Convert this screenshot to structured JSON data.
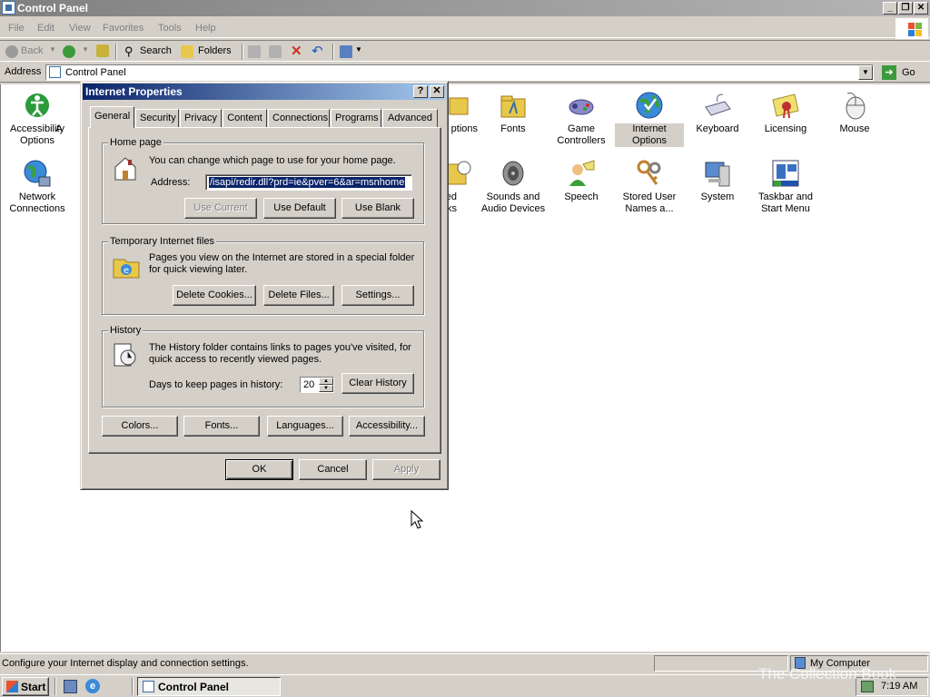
{
  "window": {
    "title": "Control Panel"
  },
  "menu": [
    "File",
    "Edit",
    "View",
    "Favorites",
    "Tools",
    "Help"
  ],
  "toolbar": {
    "back": "Back",
    "search": "Search",
    "folders": "Folders"
  },
  "address": {
    "label": "Address",
    "value": "Control Panel",
    "go": "Go"
  },
  "items": [
    {
      "label": "Accessibility Options",
      "icon": "accessibility-icon",
      "sel": false
    },
    {
      "label": "A",
      "icon": "add-hardware-icon",
      "sel": false
    },
    {
      "label": "ptions",
      "icon": "folder-options-icon",
      "sel": false
    },
    {
      "label": "Fonts",
      "icon": "fonts-folder-icon",
      "sel": false
    },
    {
      "label": "Game Controllers",
      "icon": "gamepad-icon",
      "sel": false
    },
    {
      "label": "Internet Options",
      "icon": "globe-icon",
      "sel": true
    },
    {
      "label": "Keyboard",
      "icon": "keyboard-icon",
      "sel": false
    },
    {
      "label": "Licensing",
      "icon": "certificate-icon",
      "sel": false
    },
    {
      "label": "Mouse",
      "icon": "mouse-icon",
      "sel": false
    },
    {
      "label": "Network Connections",
      "icon": "network-globe-icon",
      "sel": false
    },
    {
      "label": "uled ks",
      "icon": "scheduled-tasks-icon",
      "sel": false
    },
    {
      "label": "Sounds and Audio Devices",
      "icon": "speaker-icon",
      "sel": false
    },
    {
      "label": "Speech",
      "icon": "speech-icon",
      "sel": false
    },
    {
      "label": "Stored User Names a...",
      "icon": "keys-icon",
      "sel": false
    },
    {
      "label": "System",
      "icon": "computer-icon",
      "sel": false
    },
    {
      "label": "Taskbar and Start Menu",
      "icon": "taskbar-icon",
      "sel": false
    }
  ],
  "status": {
    "text": "Configure your Internet display and connection settings.",
    "zone": "My Computer"
  },
  "taskbar": {
    "start": "Start",
    "task": "Control Panel",
    "time": "7:19 AM"
  },
  "watermark": "The Collection Book",
  "dialog": {
    "title": "Internet Properties",
    "tabs": [
      "General",
      "Security",
      "Privacy",
      "Content",
      "Connections",
      "Programs",
      "Advanced"
    ],
    "home": {
      "legend": "Home page",
      "desc": "You can change which page to use for your home page.",
      "addr_label": "Address:",
      "url": "/isapi/redir.dll?prd=ie&pver=6&ar=msnhome",
      "btn_current": "Use Current",
      "btn_default": "Use Default",
      "btn_blank": "Use Blank"
    },
    "temp": {
      "legend": "Temporary Internet files",
      "desc": "Pages you view on the Internet are stored in a special folder for quick viewing later.",
      "btn_cookies": "Delete Cookies...",
      "btn_files": "Delete Files...",
      "btn_settings": "Settings..."
    },
    "history": {
      "legend": "History",
      "desc": "The History folder contains links to pages you've visited, for quick access to recently viewed pages.",
      "days_label": "Days to keep pages in history:",
      "days": "20",
      "btn_clear": "Clear History"
    },
    "bottom": {
      "colors": "Colors...",
      "fonts": "Fonts...",
      "languages": "Languages...",
      "accessibility": "Accessibility..."
    },
    "ok": "OK",
    "cancel": "Cancel",
    "apply": "Apply"
  }
}
